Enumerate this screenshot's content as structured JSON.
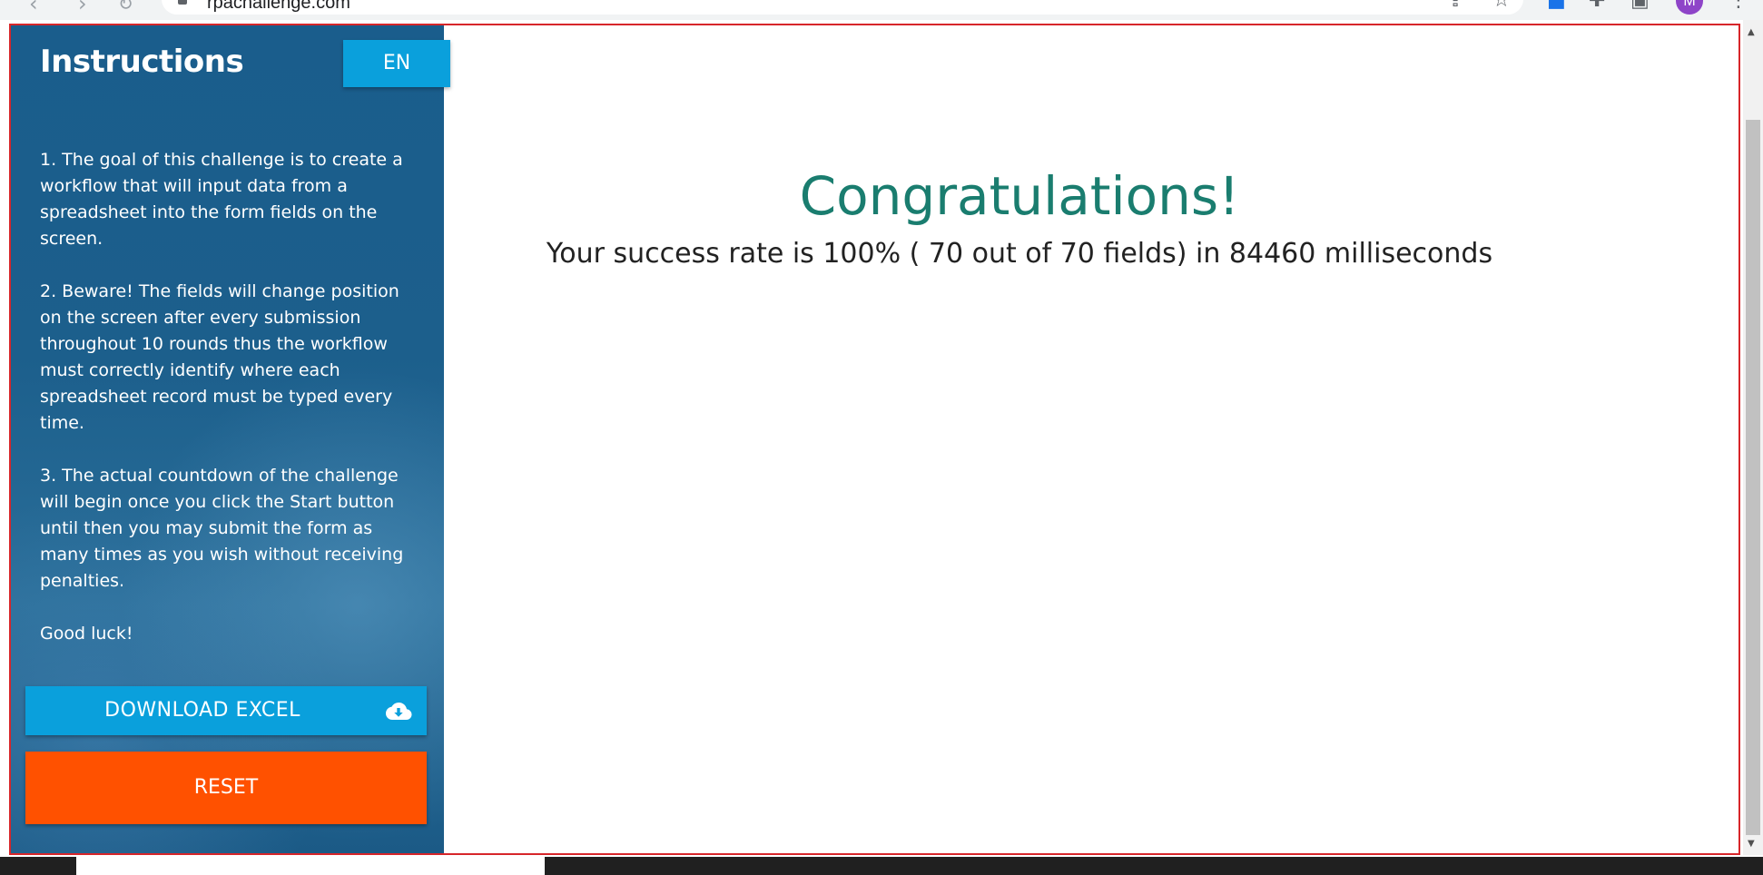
{
  "browser": {
    "url": "rpachallenge.com",
    "avatar_letter": "M"
  },
  "sidebar": {
    "title": "Instructions",
    "language_button": "EN",
    "instructions": [
      "1. The goal of this challenge is to create a workflow that will input data from a spreadsheet into the form fields on the screen.",
      "2. Beware! The fields will change position on the screen after every submission throughout 10 rounds thus the workflow must correctly identify where each spreadsheet record must be typed every time.",
      "3. The actual countdown of the challenge will begin once you click the Start button until then you may submit the form as many times as you wish without receiving penalties.",
      "Good luck!"
    ],
    "download_button": "DOWNLOAD EXCEL",
    "reset_button": "RESET"
  },
  "main": {
    "heading": "Congratulations!",
    "result": "Your success rate is 100% ( 70 out of 70 fields) in 84460 milliseconds"
  },
  "colors": {
    "accent_blue": "#0aa0dc",
    "reset_orange": "#ff5100",
    "heading_teal": "#1a7d6f",
    "frame_red": "#d7262a"
  }
}
